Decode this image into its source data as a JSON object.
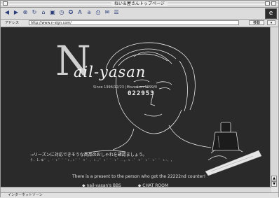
{
  "window": {
    "title": "ねい＆屋さんトップページ"
  },
  "address": {
    "label": "アドレス",
    "url": "http://www.n-sign.com/",
    "go_label": "移動",
    "dd_label": "▾"
  },
  "throbber": {
    "glyph": "e"
  },
  "toolbar": {
    "icons": [
      "back-icon",
      "forward-icon",
      "stop-icon",
      "refresh-icon",
      "home-icon",
      "autofill-icon",
      "history-icon",
      "favorites-icon",
      "larger-text-icon",
      "smaller-text-icon",
      "print-icon",
      "mail-icon",
      "preferences-icon"
    ]
  },
  "page": {
    "big_letter": "N",
    "logo_text": "ail-yasan",
    "since": "Since 1996/12/23 (Moved on 1999/0",
    "counter": "022953",
    "jp_line1": "→リーズンに対応できそうな商品のおしゃれを確認ましょう。",
    "jp_line2": "そ, 1.ゆ゜、・ゝ゜゛'ゝ,ゝ゜゛ゞ゛、ゝ,.゜ゝ゛゛ゝ゜..。ゝ .゜ゞ゛ゝ゛ゝ゛゛ゝ:、。",
    "present": "There is a present to the person who got the 22222nd counter!",
    "link1": "◆ nail-yasan's BBS",
    "link2": "◆ CHAT ROOM"
  },
  "status": {
    "text": "インターネットゾーン"
  }
}
